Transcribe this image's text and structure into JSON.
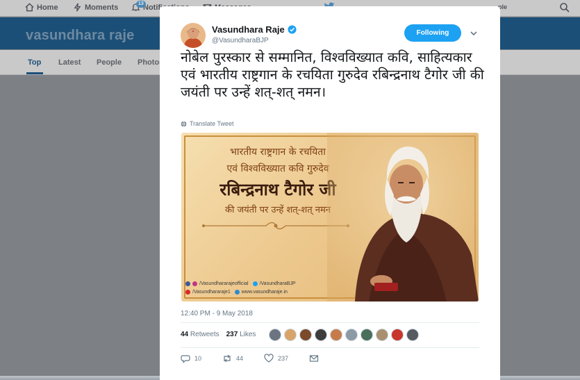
{
  "topnav": {
    "items": [
      {
        "label": "Home",
        "icon": "home-icon"
      },
      {
        "label": "Moments",
        "icon": "lightning-icon"
      },
      {
        "label": "Notifications",
        "icon": "bell-icon"
      },
      {
        "label": "Messages",
        "icon": "envelope-icon"
      }
    ],
    "notif_count": "13",
    "right_text": "ple"
  },
  "banner": {
    "title": "vasundhara raje"
  },
  "tabs": [
    {
      "label": "Top",
      "active": true
    },
    {
      "label": "Latest"
    },
    {
      "label": "People"
    },
    {
      "label": "Photos"
    }
  ],
  "tweet": {
    "name": "Vasundhara Raje",
    "handle": "@VasundharaBJP",
    "follow_label": "Following",
    "text": "नोबेल पुरस्कार से सम्मानित, विश्वविख्यात कवि, साहित्यकार एवं भारतीय राष्ट्रगान के रचयिता गुरुदेव रबिन्द्रनाथ टैगोर जी की जयंती पर उन्हें शत्-शत् नमन।",
    "translate_label": "Translate Tweet",
    "timestamp": "12:40 PM - 9 May 2018",
    "retweets_count": "44",
    "retweets_label": "Retweets",
    "likes_count": "237",
    "likes_label": "Likes",
    "reply_count": "10",
    "retweet_action_count": "44",
    "like_action_count": "237"
  },
  "poster": {
    "line1": "भारतीय राष्ट्रगान के रचयिता",
    "line2": "एवं विश्वविख्यात कवि गुरुदेव",
    "line3": "रबिन्द्रनाथ टैगोर जी",
    "line4": "की जयंती पर उन्हें शत्-शत् नमन",
    "social1a": "/Vasundhararajeofficial",
    "social1b": "/VasundharaBJP",
    "social2a": "/Vasundhararaje1",
    "social2b": "www.vasundharaje.in"
  },
  "colors": {
    "accent": "#1da1f2",
    "banner": "#1c4f77",
    "overlay": "#7d8084"
  }
}
